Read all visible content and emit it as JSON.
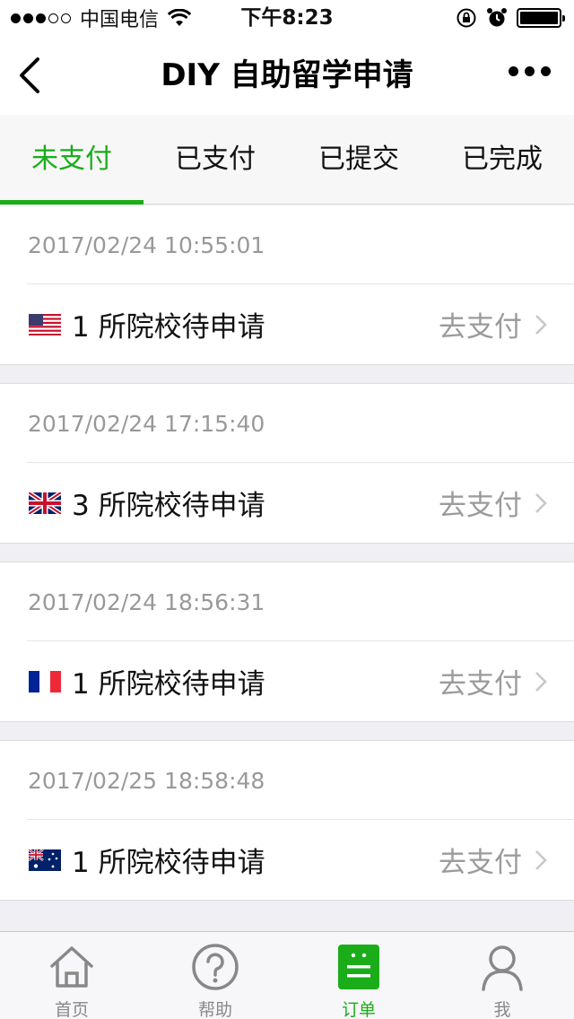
{
  "status": {
    "carrier": "中国电信",
    "time": "下午8:23"
  },
  "nav": {
    "title": "DIY 自助留学申请"
  },
  "tabs": [
    {
      "label": "未支付",
      "active": true
    },
    {
      "label": "已支付",
      "active": false
    },
    {
      "label": "已提交",
      "active": false
    },
    {
      "label": "已完成",
      "active": false
    }
  ],
  "orders": [
    {
      "time": "2017/02/24 10:55:01",
      "flag": "us-flag-icon",
      "text": "1 所院校待申请",
      "action": "去支付"
    },
    {
      "time": "2017/02/24 17:15:40",
      "flag": "uk-flag-icon",
      "text": "3 所院校待申请",
      "action": "去支付"
    },
    {
      "time": "2017/02/24 18:56:31",
      "flag": "france-flag-icon",
      "text": "1 所院校待申请",
      "action": "去支付"
    },
    {
      "time": "2017/02/25 18:58:48",
      "flag": "australia-flag-icon",
      "text": "1 所院校待申请",
      "action": "去支付"
    }
  ],
  "tabbar": [
    {
      "label": "首页",
      "icon": "home-icon",
      "active": false
    },
    {
      "label": "帮助",
      "icon": "help-icon",
      "active": false
    },
    {
      "label": "订单",
      "icon": "orders-icon",
      "active": true
    },
    {
      "label": "我",
      "icon": "profile-icon",
      "active": false
    }
  ],
  "colors": {
    "accent": "#1aad19",
    "muted_text": "#999999",
    "background": "#efeff4"
  }
}
